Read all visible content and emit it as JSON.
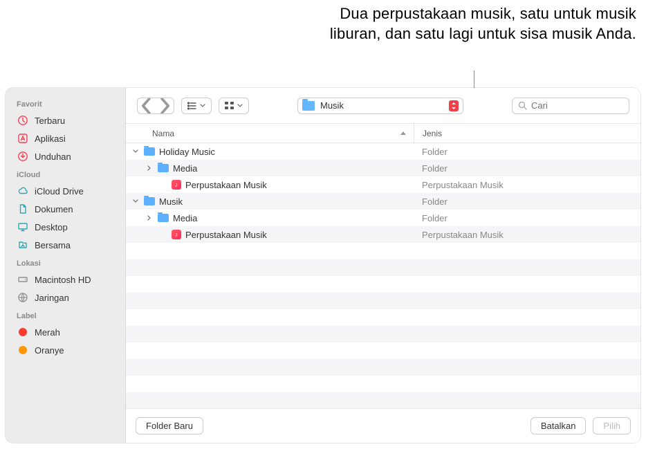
{
  "callout": "Dua perpustakaan musik, satu untuk musik liburan, dan satu lagi untuk sisa musik Anda.",
  "sidebar": {
    "sections": [
      {
        "title": "Favorit",
        "items": [
          {
            "icon": "clock-icon",
            "label": "Terbaru",
            "color": "#ff3b4e"
          },
          {
            "icon": "apps-icon",
            "label": "Aplikasi",
            "color": "#ff3b4e"
          },
          {
            "icon": "download-icon",
            "label": "Unduhan",
            "color": "#ff3b4e"
          }
        ]
      },
      {
        "title": "iCloud",
        "items": [
          {
            "icon": "cloud-icon",
            "label": "iCloud Drive",
            "color": "#2aa7b5"
          },
          {
            "icon": "doc-icon",
            "label": "Dokumen",
            "color": "#2aa7b5"
          },
          {
            "icon": "desktop-icon",
            "label": "Desktop",
            "color": "#2aa7b5"
          },
          {
            "icon": "shared-icon",
            "label": "Bersama",
            "color": "#2aa7b5"
          }
        ]
      },
      {
        "title": "Lokasi",
        "items": [
          {
            "icon": "hd-icon",
            "label": "Macintosh HD",
            "color": "#8e8e93"
          },
          {
            "icon": "globe-icon",
            "label": "Jaringan",
            "color": "#8e8e93"
          }
        ]
      },
      {
        "title": "Label",
        "items": [
          {
            "icon": "dot",
            "label": "Merah",
            "color": "#ff3b30"
          },
          {
            "icon": "dot",
            "label": "Oranye",
            "color": "#ff9500"
          }
        ]
      }
    ]
  },
  "toolbar": {
    "location": "Musik",
    "search_placeholder": "Cari"
  },
  "columns": {
    "name": "Nama",
    "kind": "Jenis"
  },
  "rows": [
    {
      "indent": 0,
      "disclosure": "down",
      "icon": "folder",
      "name": "Holiday Music",
      "kind": "Folder",
      "striped": false
    },
    {
      "indent": 1,
      "disclosure": "right",
      "icon": "folder",
      "name": "Media",
      "kind": "Folder",
      "striped": true
    },
    {
      "indent": 2,
      "disclosure": "",
      "icon": "music",
      "name": "Perpustakaan Musik",
      "kind": "Perpustakaan Musik",
      "striped": false
    },
    {
      "indent": 0,
      "disclosure": "down",
      "icon": "folder",
      "name": "Musik",
      "kind": "Folder",
      "striped": true
    },
    {
      "indent": 1,
      "disclosure": "right",
      "icon": "folder",
      "name": "Media",
      "kind": "Folder",
      "striped": false
    },
    {
      "indent": 2,
      "disclosure": "",
      "icon": "music",
      "name": "Perpustakaan Musik",
      "kind": "Perpustakaan Musik",
      "striped": true
    }
  ],
  "bottom": {
    "new_folder": "Folder Baru",
    "cancel": "Batalkan",
    "choose": "Pilih"
  }
}
